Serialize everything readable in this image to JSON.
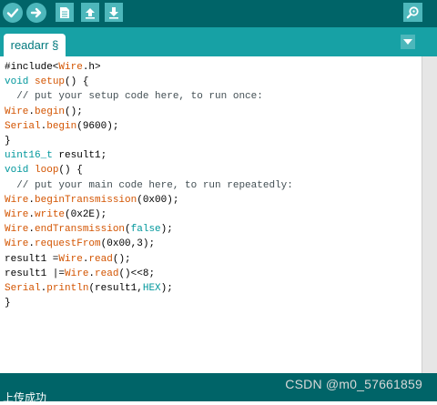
{
  "toolbar": {
    "buttons": [
      {
        "name": "verify",
        "icon": "checkmark-icon"
      },
      {
        "name": "upload",
        "icon": "arrow-right-icon"
      },
      {
        "name": "new",
        "icon": "new-file-icon"
      },
      {
        "name": "open",
        "icon": "open-arrow-up-icon"
      },
      {
        "name": "save",
        "icon": "save-arrow-down-icon"
      },
      {
        "name": "serial-monitor",
        "icon": "magnifier-icon"
      }
    ]
  },
  "tabs": [
    {
      "label": "readarr §"
    }
  ],
  "editor": {
    "lines": [
      [
        {
          "t": "#include<",
          "c": "pl"
        },
        {
          "t": "Wire",
          "c": "fn"
        },
        {
          "t": ".h>",
          "c": "pl"
        }
      ],
      [
        {
          "t": "void",
          "c": "kw"
        },
        {
          "t": " ",
          "c": "pl"
        },
        {
          "t": "setup",
          "c": "fn"
        },
        {
          "t": "() {",
          "c": "pl"
        }
      ],
      [
        {
          "t": "  // put your setup code here, to run once:",
          "c": "cm"
        }
      ],
      [
        {
          "t": "Wire",
          "c": "fn"
        },
        {
          "t": ".",
          "c": "pl"
        },
        {
          "t": "begin",
          "c": "fn"
        },
        {
          "t": "();",
          "c": "pl"
        }
      ],
      [
        {
          "t": "Serial",
          "c": "fn"
        },
        {
          "t": ".",
          "c": "pl"
        },
        {
          "t": "begin",
          "c": "fn"
        },
        {
          "t": "(9600);",
          "c": "pl"
        }
      ],
      [
        {
          "t": "}",
          "c": "pl"
        }
      ],
      [
        {
          "t": "uint16_t",
          "c": "kw"
        },
        {
          "t": " result1;",
          "c": "pl"
        }
      ],
      [
        {
          "t": "void",
          "c": "kw"
        },
        {
          "t": " ",
          "c": "pl"
        },
        {
          "t": "loop",
          "c": "fn"
        },
        {
          "t": "() {",
          "c": "pl"
        }
      ],
      [
        {
          "t": "  // put your main code here, to run repeatedly:",
          "c": "cm"
        }
      ],
      [
        {
          "t": "Wire",
          "c": "fn"
        },
        {
          "t": ".",
          "c": "pl"
        },
        {
          "t": "beginTransmission",
          "c": "fn"
        },
        {
          "t": "(0x00);",
          "c": "pl"
        }
      ],
      [
        {
          "t": "Wire",
          "c": "fn"
        },
        {
          "t": ".",
          "c": "pl"
        },
        {
          "t": "write",
          "c": "fn"
        },
        {
          "t": "(0x2E);",
          "c": "pl"
        }
      ],
      [
        {
          "t": "Wire",
          "c": "fn"
        },
        {
          "t": ".",
          "c": "pl"
        },
        {
          "t": "endTransmission",
          "c": "fn"
        },
        {
          "t": "(",
          "c": "pl"
        },
        {
          "t": "false",
          "c": "kw"
        },
        {
          "t": ");",
          "c": "pl"
        }
      ],
      [
        {
          "t": "Wire",
          "c": "fn"
        },
        {
          "t": ".",
          "c": "pl"
        },
        {
          "t": "requestFrom",
          "c": "fn"
        },
        {
          "t": "(0x00,3);",
          "c": "pl"
        }
      ],
      [
        {
          "t": "result1 =",
          "c": "pl"
        },
        {
          "t": "Wire",
          "c": "fn"
        },
        {
          "t": ".",
          "c": "pl"
        },
        {
          "t": "read",
          "c": "fn"
        },
        {
          "t": "();",
          "c": "pl"
        }
      ],
      [
        {
          "t": "result1 |=",
          "c": "pl"
        },
        {
          "t": "Wire",
          "c": "fn"
        },
        {
          "t": ".",
          "c": "pl"
        },
        {
          "t": "read",
          "c": "fn"
        },
        {
          "t": "()<<8;",
          "c": "pl"
        }
      ],
      [
        {
          "t": "Serial",
          "c": "fn"
        },
        {
          "t": ".",
          "c": "pl"
        },
        {
          "t": "println",
          "c": "fn"
        },
        {
          "t": "(result1,",
          "c": "pl"
        },
        {
          "t": "HEX",
          "c": "kw"
        },
        {
          "t": ");",
          "c": "pl"
        }
      ],
      [
        {
          "t": "}",
          "c": "pl"
        }
      ]
    ]
  },
  "status": {
    "message": "上传成功"
  },
  "watermark": "CSDN @m0_57661859",
  "colors": {
    "toolbar_bg": "#006468",
    "tabbar_bg": "#17a1a5",
    "button_bg": "#4db7bb",
    "keyword": "#00979c",
    "function": "#d35400",
    "comment": "#434f54"
  }
}
